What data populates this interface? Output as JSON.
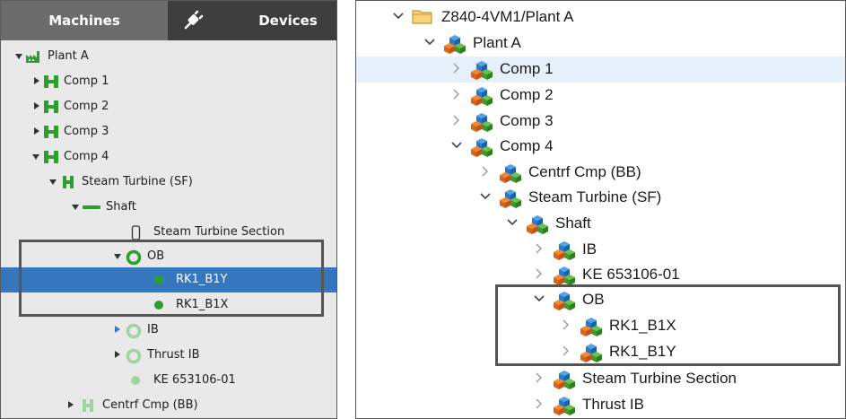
{
  "left_panel": {
    "tabs": [
      {
        "label": "Machines",
        "active": true
      },
      {
        "label": "Devices",
        "active": false,
        "icon": "plug-icon"
      }
    ],
    "tree": [
      {
        "label": "Plant A",
        "state": "expanded",
        "icon": "factory-icon"
      },
      {
        "label": "Comp 1",
        "state": "collapsed",
        "icon": "machine-icon"
      },
      {
        "label": "Comp 2",
        "state": "collapsed",
        "icon": "machine-icon"
      },
      {
        "label": "Comp 3",
        "state": "collapsed",
        "icon": "machine-icon"
      },
      {
        "label": "Comp 4",
        "state": "expanded",
        "icon": "machine-icon"
      },
      {
        "label": "Steam Turbine (SF)",
        "state": "expanded",
        "icon": "turbine-icon"
      },
      {
        "label": "Shaft",
        "state": "expanded",
        "icon": "shaft-icon"
      },
      {
        "label": "Steam Turbine Section",
        "state": "leaf",
        "icon": "section-icon"
      },
      {
        "label": "OB",
        "state": "expanded",
        "icon": "bearing-icon"
      },
      {
        "label": "RK1_B1Y",
        "state": "leaf",
        "icon": "sensor-dot-icon",
        "selected": true
      },
      {
        "label": "RK1_B1X",
        "state": "leaf",
        "icon": "sensor-dot-icon"
      },
      {
        "label": "IB",
        "state": "collapsed",
        "icon": "bearing-light-icon"
      },
      {
        "label": "Thrust IB",
        "state": "collapsed",
        "icon": "bearing-light-icon"
      },
      {
        "label": "KE 653106-01",
        "state": "leaf",
        "icon": "sensor-dot-light-icon"
      },
      {
        "label": "Centrf Cmp (BB)",
        "state": "collapsed",
        "icon": "machine-light-icon"
      }
    ]
  },
  "right_panel": {
    "tree": [
      {
        "label": "Z840-4VM1/Plant A",
        "state": "expanded",
        "icon": "folder-icon"
      },
      {
        "label": "Plant A",
        "state": "expanded",
        "icon": "cubes-icon"
      },
      {
        "label": "Comp 1",
        "state": "collapsed",
        "icon": "cubes-icon",
        "hovered": true
      },
      {
        "label": "Comp 2",
        "state": "collapsed",
        "icon": "cubes-icon"
      },
      {
        "label": "Comp 3",
        "state": "collapsed",
        "icon": "cubes-icon"
      },
      {
        "label": "Comp 4",
        "state": "expanded",
        "icon": "cubes-icon"
      },
      {
        "label": "Centrf Cmp (BB)",
        "state": "collapsed",
        "icon": "cubes-icon"
      },
      {
        "label": "Steam Turbine (SF)",
        "state": "expanded",
        "icon": "cubes-icon"
      },
      {
        "label": "Shaft",
        "state": "expanded",
        "icon": "cubes-icon"
      },
      {
        "label": "IB",
        "state": "collapsed",
        "icon": "cubes-icon"
      },
      {
        "label": "KE 653106-01",
        "state": "collapsed",
        "icon": "cubes-icon"
      },
      {
        "label": "OB",
        "state": "expanded",
        "icon": "cubes-icon"
      },
      {
        "label": "RK1_B1X",
        "state": "collapsed",
        "icon": "cubes-icon"
      },
      {
        "label": "RK1_B1Y",
        "state": "collapsed",
        "icon": "cubes-icon"
      },
      {
        "label": "Steam Turbine Section",
        "state": "collapsed",
        "icon": "cubes-icon"
      },
      {
        "label": "Thrust IB",
        "state": "collapsed",
        "icon": "cubes-icon"
      }
    ]
  },
  "colors": {
    "tree_green": "#2e9e2e",
    "tree_green_light": "#9fd49f",
    "selection_blue": "#3576be",
    "highlight_box": "#555555"
  }
}
